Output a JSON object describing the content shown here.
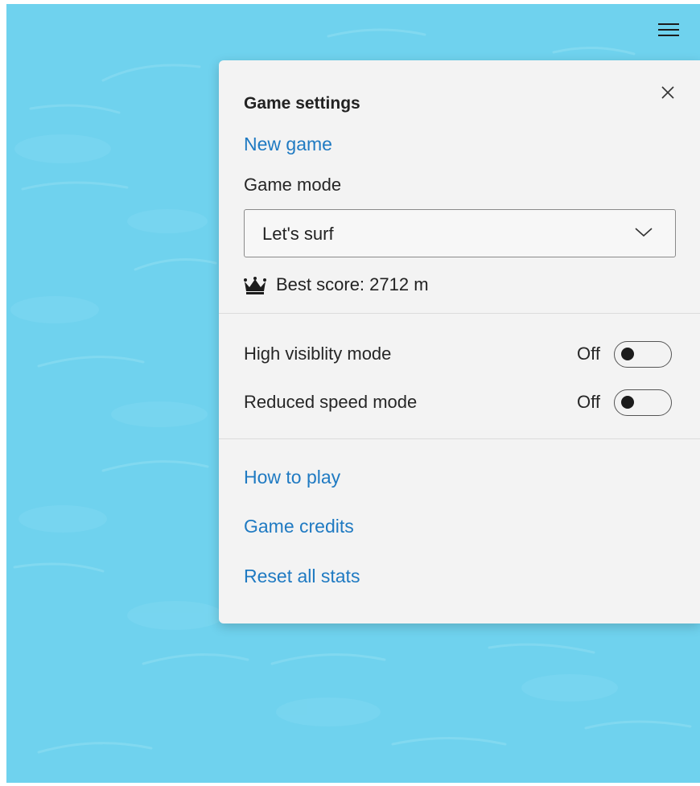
{
  "colors": {
    "sea": "#6fd2ee",
    "panel": "#f3f3f3",
    "link": "#1f7ac2"
  },
  "menu": {
    "icon": "hamburger-menu-icon"
  },
  "settings": {
    "title": "Game settings",
    "close_icon": "close-icon",
    "new_game": "New game",
    "mode_label": "Game mode",
    "mode_value": "Let's surf",
    "mode_icon": "chevron-down-icon",
    "best_score_icon": "crown-icon",
    "best_score_text": "Best score: 2712 m",
    "toggles": [
      {
        "label": "High visiblity mode",
        "state": "Off",
        "on": false
      },
      {
        "label": "Reduced speed mode",
        "state": "Off",
        "on": false
      }
    ],
    "links": {
      "how_to_play": "How to play",
      "credits": "Game credits",
      "reset": "Reset all stats"
    }
  }
}
